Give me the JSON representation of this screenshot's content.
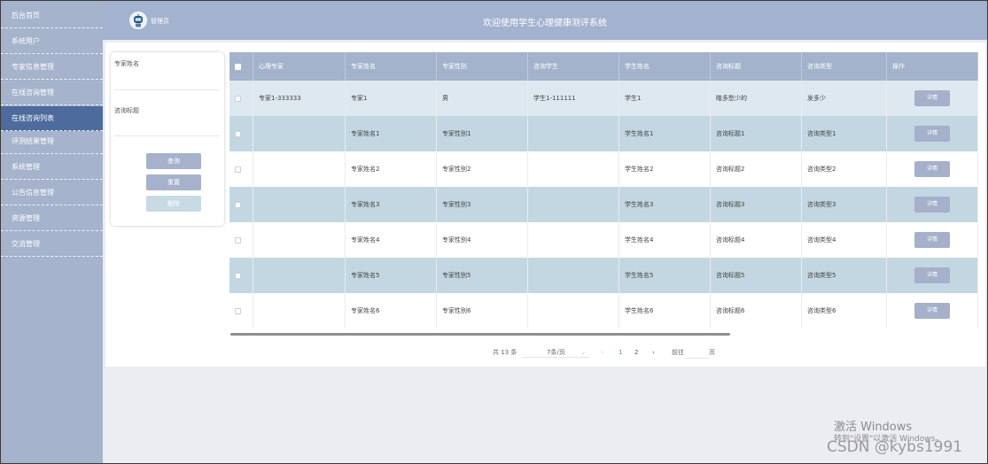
{
  "sidebar": {
    "items": [
      {
        "label": "后台首页",
        "active": false
      },
      {
        "label": "系统用户",
        "active": false
      },
      {
        "label": "专家信息管理",
        "active": false
      },
      {
        "label": "在线咨询管理",
        "active": false
      },
      {
        "label": "在线咨询列表",
        "active": true
      },
      {
        "label": "评测结果管理",
        "active": false
      },
      {
        "label": "系统管理",
        "active": false
      },
      {
        "label": "公告信息管理",
        "active": false
      },
      {
        "label": "资源管理",
        "active": false
      },
      {
        "label": "交流管理",
        "active": false
      }
    ]
  },
  "header": {
    "admin_label": "管理员",
    "title": "欢迎使用学生心理健康测评系统",
    "avatar_icon": "robot-avatar-icon"
  },
  "search": {
    "field1_label": "专家姓名",
    "field2_label": "咨询标题",
    "query_button": "查询",
    "reset_button": "重置",
    "delete_button": "删除"
  },
  "table": {
    "headers": [
      "心理专家",
      "专家姓名",
      "专家性别",
      "咨询学生",
      "学生姓名",
      "咨询标题",
      "咨询类型",
      "操作"
    ],
    "rows": [
      [
        "专家1-333333",
        "专家1",
        "男",
        "学生1-111111",
        "学生1",
        "瞎多愁少的",
        "发多少"
      ],
      [
        "",
        "专家姓名1",
        "专家性别1",
        "",
        "学生姓名1",
        "咨询标题1",
        "咨询类型1"
      ],
      [
        "",
        "专家姓名2",
        "专家性别2",
        "",
        "学生姓名2",
        "咨询标题2",
        "咨询类型2"
      ],
      [
        "",
        "专家姓名3",
        "专家性别3",
        "",
        "学生姓名3",
        "咨询标题3",
        "咨询类型3"
      ],
      [
        "",
        "专家姓名4",
        "专家性别4",
        "",
        "学生姓名4",
        "咨询标题4",
        "咨询类型4"
      ],
      [
        "",
        "专家姓名5",
        "专家性别5",
        "",
        "学生姓名5",
        "咨询标题5",
        "咨询类型5"
      ],
      [
        "",
        "专家姓名6",
        "专家性别6",
        "",
        "学生姓名6",
        "咨询标题6",
        "咨询类型6"
      ]
    ],
    "detail_label": "详情"
  },
  "pagination": {
    "total": "共 13 条",
    "page_size": "7条/页",
    "prev": "‹",
    "pages": [
      "1",
      "2"
    ],
    "next": "›",
    "goto_label": "前往",
    "page_unit": "页"
  },
  "watermark": {
    "activate_title": "激活 Windows",
    "activate_sub": "转到\"设置\"以激活 Windows。",
    "credit": "CSDN @kybs1991"
  },
  "colors": {
    "sidebar": "#a6b3cc",
    "sidebar_active": "#4d6b9c",
    "header": "#a3b2ce",
    "row_even": "#c2d7e1",
    "row_hover": "#dde8f0",
    "row_white": "#ffffff",
    "button": "#a5b1ca"
  }
}
